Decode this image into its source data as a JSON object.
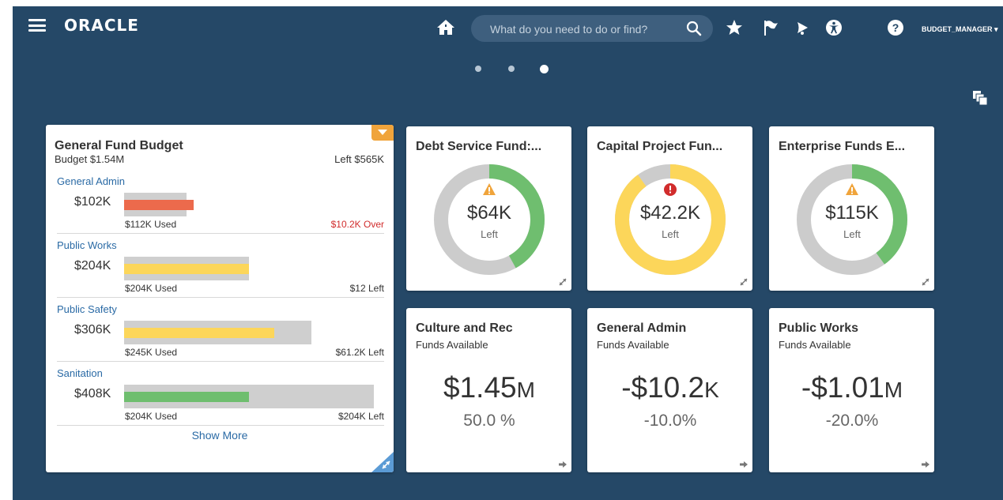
{
  "header": {
    "brand": "ORACLE",
    "search_placeholder": "What do you need to do or find?",
    "user": "BUDGET_MANAGER ▾"
  },
  "icons": {
    "menu": "hamburger-menu-icon",
    "home": "home-icon",
    "search": "search-icon",
    "favorites": "star-icon",
    "watchlist": "flag-icon",
    "notifications": "bell-icon",
    "accessibility": "accessibility-icon",
    "help": "help-icon"
  },
  "pager": {
    "count": 3,
    "active": 2
  },
  "budget_card": {
    "title": "General Fund Budget",
    "budget": "Budget $1.54M",
    "left": "Left $565K",
    "show_more": "Show More",
    "sections": [
      {
        "name": "General Admin",
        "amount": "$102K",
        "used": "$112K Used",
        "remaining": "$10.2K Over",
        "over": true,
        "track": 0.25,
        "fill": 0.28,
        "color": "#ec6a4c"
      },
      {
        "name": "Public Works",
        "amount": "$204K",
        "used": "$204K Used",
        "remaining": "$12  Left",
        "over": false,
        "track": 0.5,
        "fill": 0.5,
        "color": "#fcd65a"
      },
      {
        "name": "Public Safety",
        "amount": "$306K",
        "used": "$245K Used",
        "remaining": "$61.2K Left",
        "over": false,
        "track": 0.75,
        "fill": 0.6,
        "color": "#fcd65a"
      },
      {
        "name": "Sanitation",
        "amount": "$408K",
        "used": "$204K Used",
        "remaining": "$204K Left",
        "over": false,
        "track": 1.0,
        "fill": 0.5,
        "color": "#6fbe6f"
      }
    ]
  },
  "donut_cards": [
    {
      "title": "Debt Service Fund:...",
      "value": "$64K",
      "label": "Left",
      "status": "warning",
      "status_icon": "warning-triangle-icon",
      "used": 0.42,
      "used_color": "#6fbe6f",
      "remaining_color": "#cccccc",
      "track_first": true
    },
    {
      "title": "Capital Project Fun...",
      "value": "$42.2K",
      "label": "Left",
      "status": "error",
      "status_icon": "error-circle-icon",
      "used": 0.9,
      "used_color": "#fcd65a",
      "remaining_color": "#cccccc",
      "track_first": true
    },
    {
      "title": "Enterprise Funds E...",
      "value": "$115K",
      "label": "Left",
      "status": "warning",
      "status_icon": "warning-triangle-icon",
      "used": 0.4,
      "used_color": "#6fbe6f",
      "remaining_color": "#cccccc",
      "track_first": true
    }
  ],
  "fund_cards": [
    {
      "title": "Culture and Rec",
      "subtitle": "Funds Available",
      "value": "$1.45",
      "suffix": "M",
      "percent": "50.0 %"
    },
    {
      "title": "General Admin",
      "subtitle": "Funds Available",
      "value": "-$10.2",
      "suffix": "K",
      "percent": "-10.0%"
    },
    {
      "title": "Public Works",
      "subtitle": "Funds Available",
      "value": "-$1.01",
      "suffix": "M",
      "percent": "-20.0%"
    }
  ],
  "colors": {
    "background": "#254867",
    "link": "#2a6aa5",
    "over": "#d12c2c",
    "accent": "#f0a43b"
  }
}
